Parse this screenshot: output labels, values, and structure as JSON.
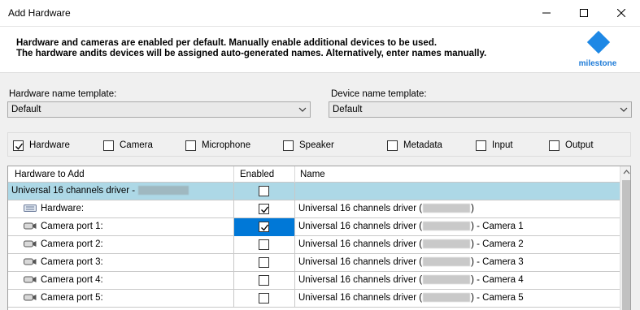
{
  "window": {
    "title": "Add Hardware"
  },
  "banner": {
    "line1": "Hardware and cameras are enabled per default. Manually enable additional devices to be used.",
    "line2": "The hardware andits devices will be assigned auto-generated names. Alternatively, enter names manually.",
    "logo_text": "milestone"
  },
  "templates": {
    "hardware_label": "Hardware name template:",
    "hardware_value": "Default",
    "device_label": "Device name template:",
    "device_value": "Default"
  },
  "filters": [
    {
      "label": "Hardware",
      "checked": true
    },
    {
      "label": "Camera",
      "checked": false
    },
    {
      "label": "Microphone",
      "checked": false
    },
    {
      "label": "Speaker",
      "checked": false
    },
    {
      "label": "Metadata",
      "checked": false
    },
    {
      "label": "Input",
      "checked": false
    },
    {
      "label": "Output",
      "checked": false
    }
  ],
  "grid": {
    "columns": [
      "Hardware to Add",
      "Enabled",
      "Name"
    ],
    "group_label": "Universal 16 channels driver - ",
    "rows": [
      {
        "label": "Hardware:",
        "enabled": true,
        "name_prefix": "Universal 16 channels driver (",
        "name_suffix": ")"
      },
      {
        "label": "Camera port 1:",
        "enabled": true,
        "name_prefix": "Universal 16 channels driver (",
        "name_suffix": ") - Camera 1"
      },
      {
        "label": "Camera port 2:",
        "enabled": false,
        "name_prefix": "Universal 16 channels driver (",
        "name_suffix": ") - Camera 2"
      },
      {
        "label": "Camera port 3:",
        "enabled": false,
        "name_prefix": "Universal 16 channels driver (",
        "name_suffix": ") - Camera 3"
      },
      {
        "label": "Camera port 4:",
        "enabled": false,
        "name_prefix": "Universal 16 channels driver (",
        "name_suffix": ") - Camera 4"
      },
      {
        "label": "Camera port 5:",
        "enabled": false,
        "name_prefix": "Universal 16 channels driver (",
        "name_suffix": ") - Camera 5"
      }
    ]
  },
  "colors": {
    "group_row": "#add8e6",
    "selection": "#0078d7",
    "brand": "#1e88e5"
  },
  "icons": {
    "hardware_row": "hardware-device-icon",
    "camera_row": "camera-icon"
  }
}
